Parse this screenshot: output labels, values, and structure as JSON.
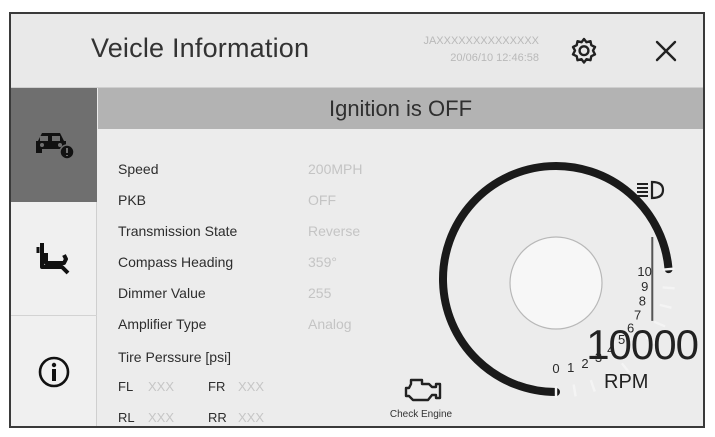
{
  "header": {
    "title": "Veicle Information",
    "vin": "JAXXXXXXXXXXXXXX",
    "datetime": "20/06/10 12:46:58",
    "settings_icon": "gear-icon",
    "close_icon": "close-icon"
  },
  "sidebar": {
    "items": [
      {
        "icon": "vehicle-info-icon",
        "active": true
      },
      {
        "icon": "seat-icon",
        "active": false
      },
      {
        "icon": "info-icon",
        "active": false
      }
    ]
  },
  "status_banner": "Ignition is OFF",
  "info": {
    "rows": [
      {
        "label": "Speed",
        "value": "200MPH"
      },
      {
        "label": "PKB",
        "value": "OFF"
      },
      {
        "label": "Transmission State",
        "value": "Reverse"
      },
      {
        "label": "Compass Heading",
        "value": "359°"
      },
      {
        "label": "Dimmer Value",
        "value": "255"
      },
      {
        "label": "Amplifier Type",
        "value": "Analog"
      }
    ],
    "tire_title": "Tire Perssure [psi]",
    "tires": {
      "FL": {
        "label": "FL",
        "value": "XXX"
      },
      "FR": {
        "label": "FR",
        "value": "XXX"
      },
      "RL": {
        "label": "RL",
        "value": "XXX"
      },
      "RR": {
        "label": "RR",
        "value": "XXX"
      }
    }
  },
  "gauge": {
    "ticks": [
      "0",
      "1",
      "2",
      "3",
      "4",
      "5",
      "6",
      "7",
      "8",
      "9",
      "10"
    ],
    "needle_value": 7,
    "rpm_value": "10000",
    "rpm_unit": "RPM",
    "check_engine_label": "Check Engine",
    "headlight_icon": "headlight-icon",
    "engine_icon": "check-engine-icon"
  },
  "colors": {
    "active_tab": "#6f6f6f",
    "banner": "#b3b3b3",
    "value_text": "#c4c4c4"
  }
}
